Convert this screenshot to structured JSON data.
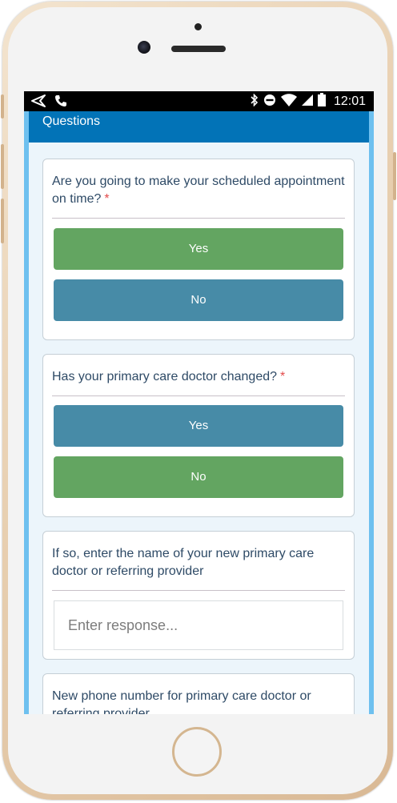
{
  "status_bar": {
    "time": "12:01",
    "icons": [
      "back-arrow-icon",
      "phone-icon",
      "bluetooth-icon",
      "do-not-disturb-icon",
      "wifi-icon",
      "cell-signal-icon",
      "battery-icon"
    ]
  },
  "header": {
    "title": "Questions"
  },
  "questions": [
    {
      "text": "Are you going to make your scheduled appointment on time?",
      "required": "*",
      "option_yes": "Yes",
      "option_no": "No"
    },
    {
      "text": "Has your primary care doctor changed?",
      "required": "*",
      "option_yes": "Yes",
      "option_no": "No"
    },
    {
      "text": "If so, enter the name of your new primary care doctor or referring provider",
      "input_placeholder": "Enter response..."
    },
    {
      "text": "New phone number for primary care doctor or referring provider"
    }
  ],
  "colors": {
    "header": "#0273b7",
    "green_button": "#63a561",
    "blue_button": "#478ba7",
    "required": "#e34b4b",
    "question_text": "#2e4a66"
  }
}
